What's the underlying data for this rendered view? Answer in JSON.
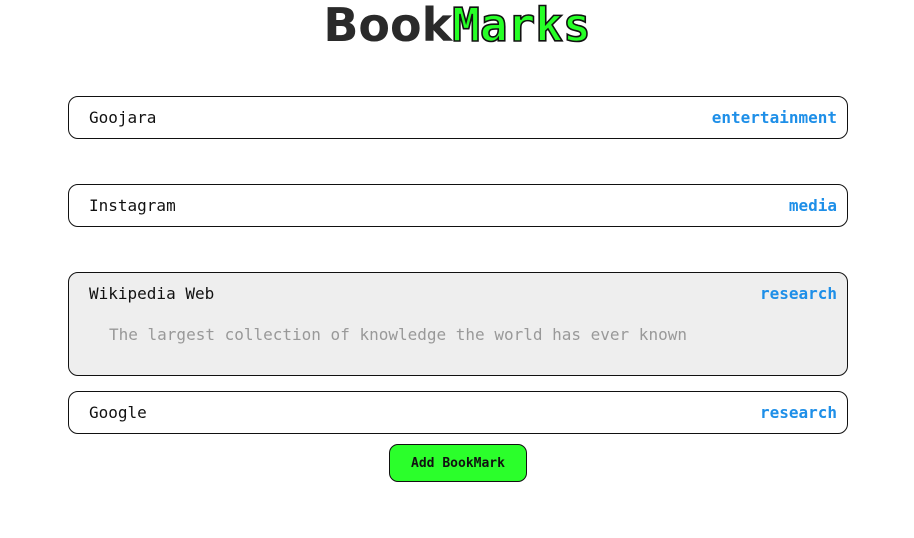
{
  "header": {
    "title_part1": "Book",
    "title_part2": "Marks",
    "accent_color": "#27ff27"
  },
  "bookmarks": [
    {
      "name": "Goojara",
      "category": "entertainment"
    },
    {
      "name": "Instagram",
      "category": "media"
    },
    {
      "name": "Wikipedia Web",
      "category": "research",
      "description": "The largest collection of knowledge the world has ever known",
      "expanded": true
    },
    {
      "name": "Google",
      "category": "research"
    }
  ],
  "category_color": "#1e8fe8",
  "actions": {
    "add_label": "Add BookMark",
    "add_color": "#2bff2b"
  }
}
